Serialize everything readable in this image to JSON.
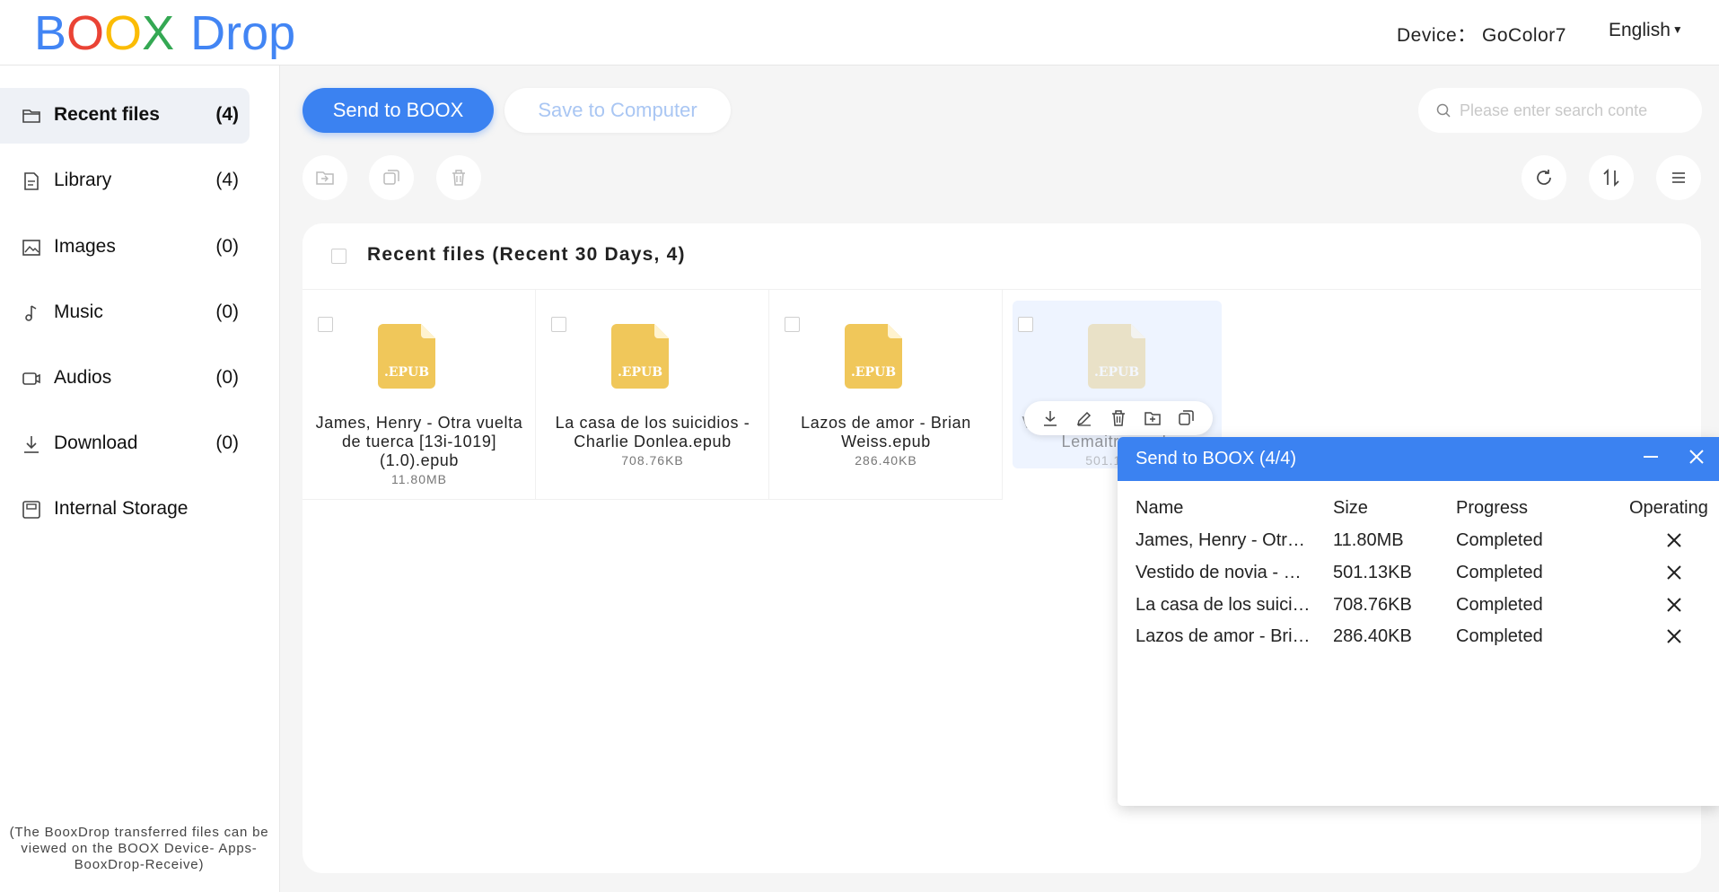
{
  "header": {
    "logo": {
      "b": "B",
      "o1": "O",
      "o2": "O",
      "x": "X",
      "drop": "Drop"
    },
    "device_label": "Device：",
    "device_name": "GoColor7",
    "language": "English"
  },
  "sidebar": {
    "items": [
      {
        "label": "Recent files",
        "count": "(4)",
        "icon": "folder-icon",
        "active": true
      },
      {
        "label": "Library",
        "count": "(4)",
        "icon": "book-icon"
      },
      {
        "label": "Images",
        "count": "(0)",
        "icon": "image-icon"
      },
      {
        "label": "Music",
        "count": "(0)",
        "icon": "music-note-icon"
      },
      {
        "label": "Audios",
        "count": "(0)",
        "icon": "audio-icon"
      },
      {
        "label": "Download",
        "count": "(0)",
        "icon": "download-icon"
      },
      {
        "label": "Internal Storage",
        "count": "",
        "icon": "storage-icon"
      }
    ],
    "note": "(The BooxDrop transferred files can be viewed on the BOOX Device- Apps-BooxDrop-Receive)"
  },
  "toolbar": {
    "send_label": "Send to BOOX",
    "save_label": "Save to Computer",
    "search_placeholder": "Please enter search conte"
  },
  "panel": {
    "title": "Recent files (Recent 30 Days, 4)",
    "files": [
      {
        "name": "James, Henry - Otra vuelta de tuerca [13i-1019] (1.0).epub",
        "size": "11.80MB"
      },
      {
        "name": "La casa de los suicidios - Charlie Donlea.epub",
        "size": "708.76KB"
      },
      {
        "name": "Lazos de amor - Brian Weiss.epub",
        "size": "286.40KB"
      },
      {
        "name": "Vestido de novia - Pierre Lemaitre.epub",
        "size": "501.13KB"
      }
    ]
  },
  "dialog": {
    "title": "Send to BOOX  (4/4)",
    "columns": [
      "Name",
      "Size",
      "Progress",
      "Operating"
    ],
    "rows": [
      {
        "name": "James, Henry - Otra vuelta de tuerca",
        "size": "11.80MB",
        "progress": "Completed"
      },
      {
        "name": "Vestido de novia - Pierre",
        "size": "501.13KB",
        "progress": "Completed"
      },
      {
        "name": "La casa de los suicidios",
        "size": "708.76KB",
        "progress": "Completed"
      },
      {
        "name": "Lazos de amor - Brian Weiss",
        "size": "286.40KB",
        "progress": "Completed"
      }
    ]
  },
  "colors": {
    "accent": "#3b82f1",
    "epub_icon": "#f0c75a"
  }
}
